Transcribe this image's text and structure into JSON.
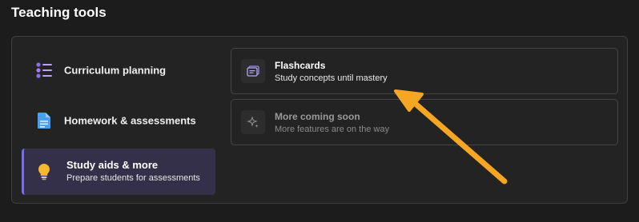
{
  "page": {
    "heading": "Teaching tools"
  },
  "sidebar": {
    "items": [
      {
        "label": "Curriculum planning",
        "icon": "list-icon"
      },
      {
        "label": "Homework & assessments",
        "icon": "document-icon"
      },
      {
        "label": "Study aids & more",
        "subtitle": "Prepare students for assessments",
        "icon": "lightbulb-icon",
        "selected": true
      }
    ]
  },
  "cards": [
    {
      "title": "Flashcards",
      "description": "Study concepts until mastery",
      "icon": "flashcards-icon",
      "enabled": true
    },
    {
      "title": "More coming soon",
      "description": "More features are on the way",
      "icon": "sparkle-icon",
      "enabled": false
    }
  ],
  "colors": {
    "accent": "#7a6cf0",
    "selected_bg": "#34304a",
    "annotation_arrow": "#f5a623",
    "icon_purple": "#8b6cf0",
    "icon_blue": "#4a9ef0",
    "icon_yellow": "#f5b82e"
  }
}
